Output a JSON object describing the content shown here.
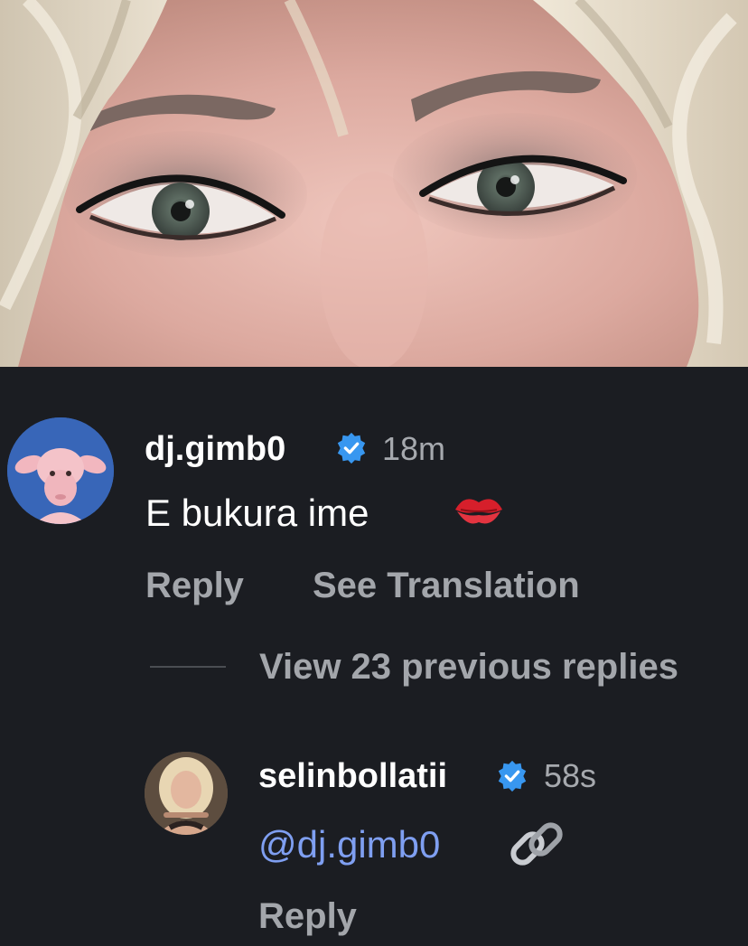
{
  "photo": {
    "description_icon": "face-close-up-photo"
  },
  "comments": [
    {
      "username": "dj.gimb0",
      "verified": true,
      "time": "18m",
      "text": "E bukura ime",
      "emoji": "kiss-mark",
      "avatar": "pink-sheep-avatar",
      "actions": {
        "reply": "Reply",
        "translate": "See Translation"
      }
    },
    {
      "username": "selinbollatii",
      "verified": true,
      "time": "58s",
      "mention": "@dj.gimb0",
      "emoji": "link",
      "avatar": "woman-portrait-avatar",
      "actions": {
        "reply": "Reply"
      }
    }
  ],
  "view_replies": "View 23 previous replies",
  "colors": {
    "background": "#1b1d22",
    "verified_badge": "#3897f0",
    "mention": "#7f9ff1",
    "secondary_text": "#a3a6ab",
    "avatar_bg_1": "#3866b8"
  }
}
